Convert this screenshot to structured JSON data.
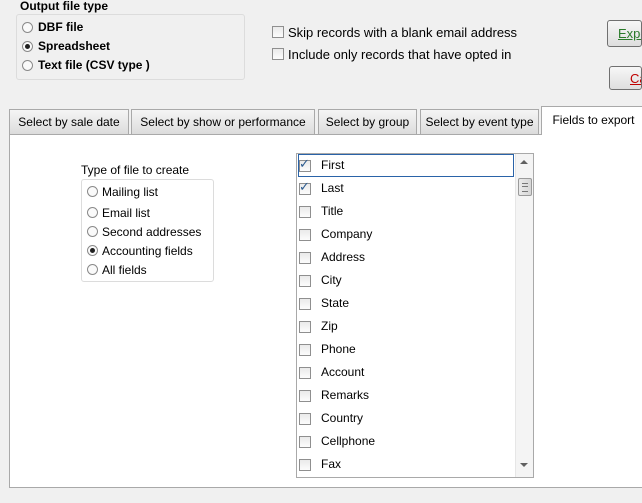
{
  "output_type": {
    "title": "Output file type",
    "options": [
      {
        "label": "DBF file",
        "selected": false
      },
      {
        "label": "Spreadsheet",
        "selected": true
      },
      {
        "label": "Text file (CSV type )",
        "selected": false
      }
    ]
  },
  "checks": [
    {
      "label": "Skip records with a blank email address",
      "checked": false
    },
    {
      "label": "Include only records that have opted in",
      "checked": false
    }
  ],
  "buttons": {
    "export": "Export",
    "cancel": "Cancel"
  },
  "tabs": [
    {
      "label": "Select by sale date",
      "active": false
    },
    {
      "label": "Select by show or performance",
      "active": false
    },
    {
      "label": "Select by group",
      "active": false
    },
    {
      "label": "Select by event type",
      "active": false
    },
    {
      "label": "Fields to export",
      "active": true
    }
  ],
  "file_type": {
    "title": "Type of file to create",
    "options": [
      {
        "label": "Mailing list",
        "selected": false
      },
      {
        "label": "Email list",
        "selected": false
      },
      {
        "label": "Second addresses",
        "selected": false
      },
      {
        "label": "Accounting fields",
        "selected": true
      },
      {
        "label": "All fields",
        "selected": false
      }
    ]
  },
  "fields": [
    {
      "label": "First",
      "checked": true
    },
    {
      "label": "Last",
      "checked": true
    },
    {
      "label": "Title",
      "checked": false
    },
    {
      "label": "Company",
      "checked": false
    },
    {
      "label": "Address",
      "checked": false
    },
    {
      "label": "City",
      "checked": false
    },
    {
      "label": "State",
      "checked": false
    },
    {
      "label": "Zip",
      "checked": false
    },
    {
      "label": "Phone",
      "checked": false
    },
    {
      "label": "Account",
      "checked": false
    },
    {
      "label": "Remarks",
      "checked": false
    },
    {
      "label": "Country",
      "checked": false
    },
    {
      "label": "Cellphone",
      "checked": false
    },
    {
      "label": "Fax",
      "checked": false
    }
  ],
  "colors": {
    "accent": "#2c5b8f",
    "export_text": "#2a7a2a",
    "cancel_text": "#c00000",
    "focus": "#2a63a8"
  }
}
